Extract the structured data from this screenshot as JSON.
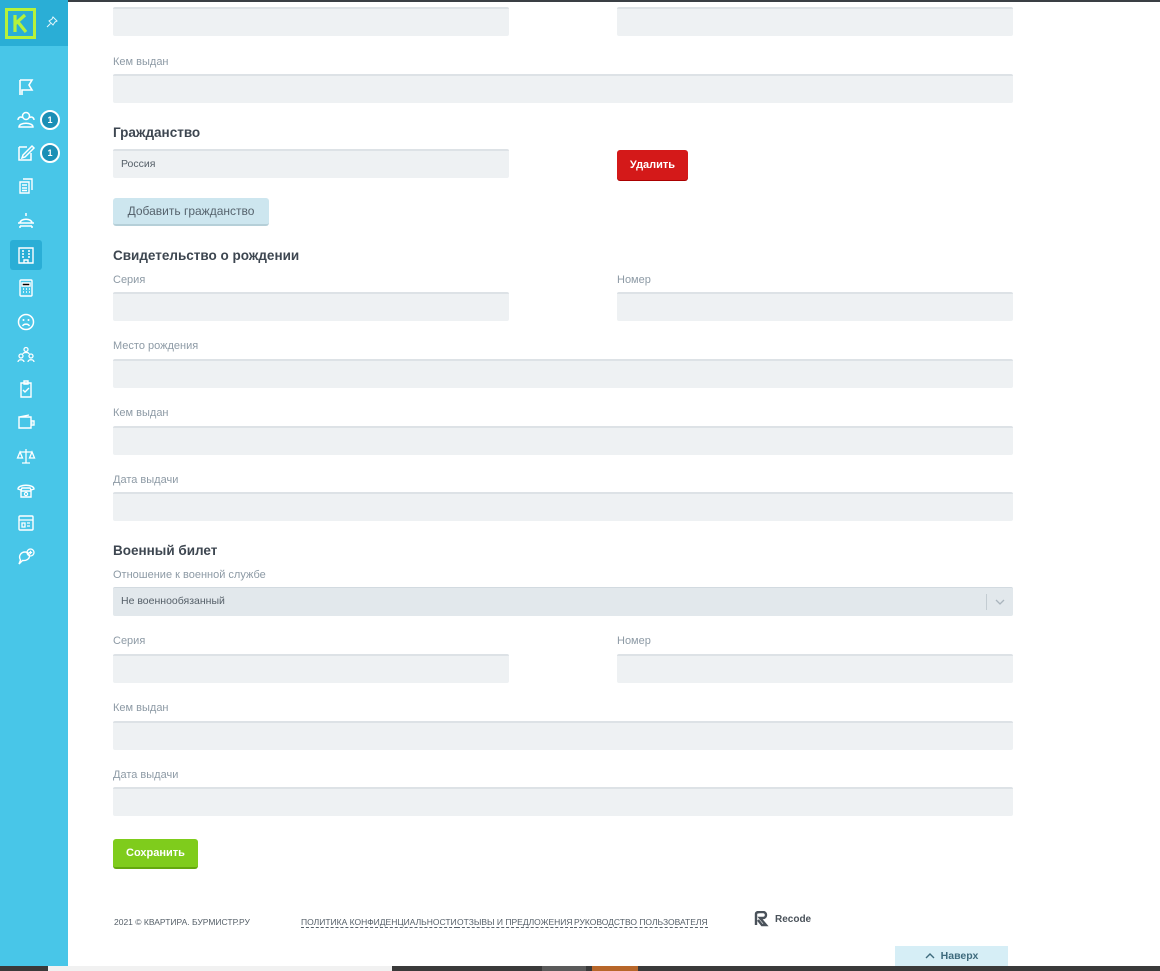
{
  "sidebar": {
    "logo_letter": "K",
    "items": [
      {
        "icon": "flag-icon"
      },
      {
        "icon": "users-icon",
        "badge": "1"
      },
      {
        "icon": "edit-icon",
        "badge": "1"
      },
      {
        "icon": "documents-icon"
      },
      {
        "icon": "service-icon"
      },
      {
        "icon": "building-icon",
        "active": true
      },
      {
        "icon": "calculator-icon"
      },
      {
        "icon": "sad-face-icon"
      },
      {
        "icon": "team-icon"
      },
      {
        "icon": "checklist-icon"
      },
      {
        "icon": "wallet-icon"
      },
      {
        "icon": "scales-icon"
      },
      {
        "icon": "phone-icon"
      },
      {
        "icon": "dashboard-icon"
      },
      {
        "icon": "chat-add-icon"
      }
    ]
  },
  "passport_tail": {
    "issued_by_label": "Кем выдан"
  },
  "citizenship": {
    "title": "Гражданство",
    "value": "Россия",
    "delete_label": "Удалить",
    "add_label": "Добавить гражданство"
  },
  "birth_certificate": {
    "title": "Свидетельство о рождении",
    "series_label": "Серия",
    "number_label": "Номер",
    "birthplace_label": "Место рождения",
    "issued_by_label": "Кем выдан",
    "issue_date_label": "Дата выдачи"
  },
  "military_id": {
    "title": "Военный билет",
    "relation_label": "Отношение к военной службе",
    "relation_value": "Не военнообязанный",
    "series_label": "Серия",
    "number_label": "Номер",
    "issued_by_label": "Кем выдан",
    "issue_date_label": "Дата выдачи"
  },
  "save_label": "Сохранить",
  "footer": {
    "copyright": "2021 © КВАРТИРА. БУРМИСТР.РУ",
    "privacy": "ПОЛИТИКА КОНФИДЕНЦИАЛЬНОСТИ",
    "feedback": "ОТЗЫВЫ И ПРЕДЛОЖЕНИЯ",
    "manual": "РУКОВОДСТВО ПОЛЬЗОВАТЕЛЯ",
    "brand": "Recode",
    "to_top": "Наверх"
  },
  "colors": {
    "sidebar": "#48c6e8",
    "delete": "#d41919",
    "save": "#7fcc1c",
    "logo": "#b6f23a"
  }
}
